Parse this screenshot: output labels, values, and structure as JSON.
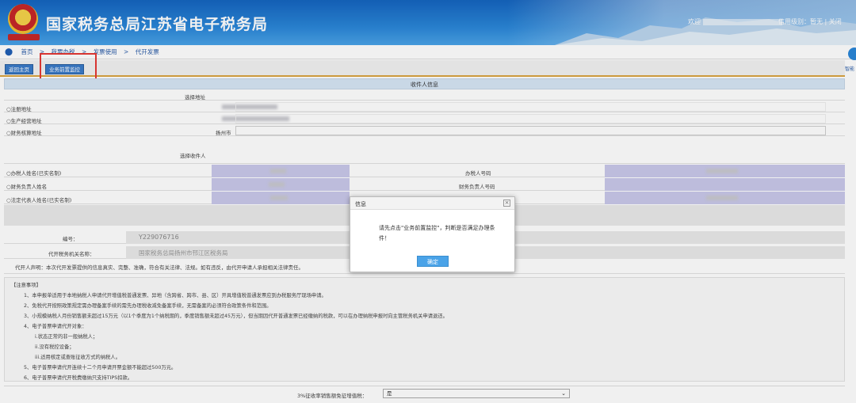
{
  "header": {
    "site_title": "国家税务总局江苏省电子税务局",
    "emblem_motto": "中国税务",
    "welcome": "欢迎",
    "credit_level": "信用级别：暂无",
    "separator": "|",
    "close": "关闭"
  },
  "breadcrumb": {
    "items": [
      "首页",
      ">",
      "我要办税",
      ">",
      "发票使用",
      ">",
      "代开发票"
    ]
  },
  "side_help": {
    "label": "智能"
  },
  "toolbar": {
    "back_label": "返回主页",
    "monitor_label": "业务前置监控"
  },
  "form": {
    "section_title": "收件人信息",
    "select_address_label": "选择地址",
    "address_options": [
      "○注册地址",
      "○生产经营地址",
      "○财务核算地址"
    ],
    "city_value": "扬州市",
    "select_recipient_label": "选择收件人",
    "recipients": [
      {
        "label": "○办税人姓名(已实名制)",
        "right_label": "办税人号码"
      },
      {
        "label": "○财务负责人姓名",
        "right_label": "财务负责人号码"
      },
      {
        "label": "○法定代表人姓名(已实名制)",
        "right_label": ""
      }
    ],
    "number_label": "编号：",
    "number_value": "Y229076716",
    "office_label": "代开税务机关名称：",
    "office_value": "国家税务总局扬州市邗江区税务局",
    "declaration": "代开人声明：本次代开发票提供的信息真实、完整、准确，符合有关法律、法规。如有违反，由代开申请人承担相关法律责任。"
  },
  "notes": {
    "title": "【注意事项】",
    "lines": [
      "1、本申报单适用于本地纳税人申请代开增值税普通发票、异地（含跨省、跨市、县、区）开具增值税普通发票应到办税服务厅现场申请。",
      "2、免税代开按照政策规定需办理备案手续的需先办理税收减免备案手续，无需备案的必须符合政策条件和范围。",
      "3、小规模纳税人月份销售额未超过15万元（以1个季度为1个纳税期的，季度销售额未超过45万元），但当期因代开普通发票已经缴纳的税款，可以在办理纳税申报时向主管税务机关申请退还。",
      "4、电子普票申请代开对象：",
      "i.状态正常的非一般纳税人；",
      "ii.没有税控设备；",
      "iii.适用核定或查账征收方式的纳税人。",
      "5、电子普票申请代开连续十二个月申请开票金额不能超过500万元。",
      "6、电子普票申请代开税费缴纳只支持TIPS扣款。"
    ]
  },
  "bottom": {
    "label": "3%征收率销售额免征增值税：",
    "select_value": "是"
  },
  "dialog": {
    "title": "信息",
    "message": "请先点击\"业务前置监控\"，判断是否满足办理条件！",
    "ok_label": "确定"
  },
  "colors": {
    "banner": "#1f78d1",
    "highlight_box": "#e53935",
    "purple_cell": "#c9c8ea",
    "button": "#3a7bc8"
  }
}
